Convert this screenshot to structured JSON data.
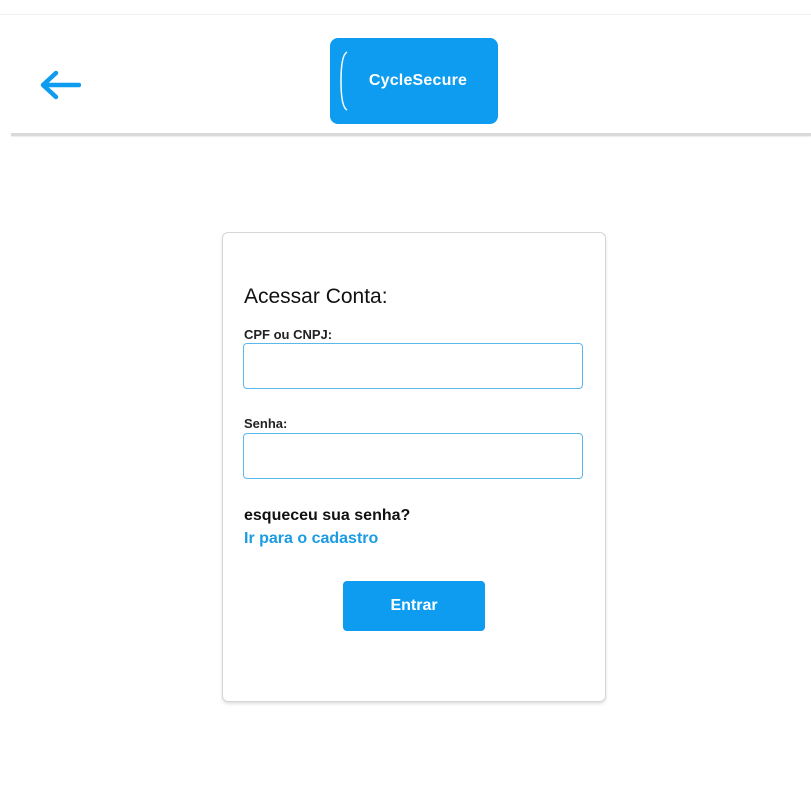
{
  "header": {
    "back_icon": "arrow-left-icon",
    "logo_text": "CycleSecure",
    "accent_color": "#0d9cf0"
  },
  "login_card": {
    "title": "Acessar Conta:",
    "cpf_label": "CPF ou CNPJ:",
    "cpf_value": "",
    "password_label": "Senha:",
    "password_value": "",
    "forgot_text": "esqueceu sua senha?",
    "register_link": "Ir para o cadastro",
    "submit_label": "Entrar",
    "link_color": "#1a9be3"
  }
}
